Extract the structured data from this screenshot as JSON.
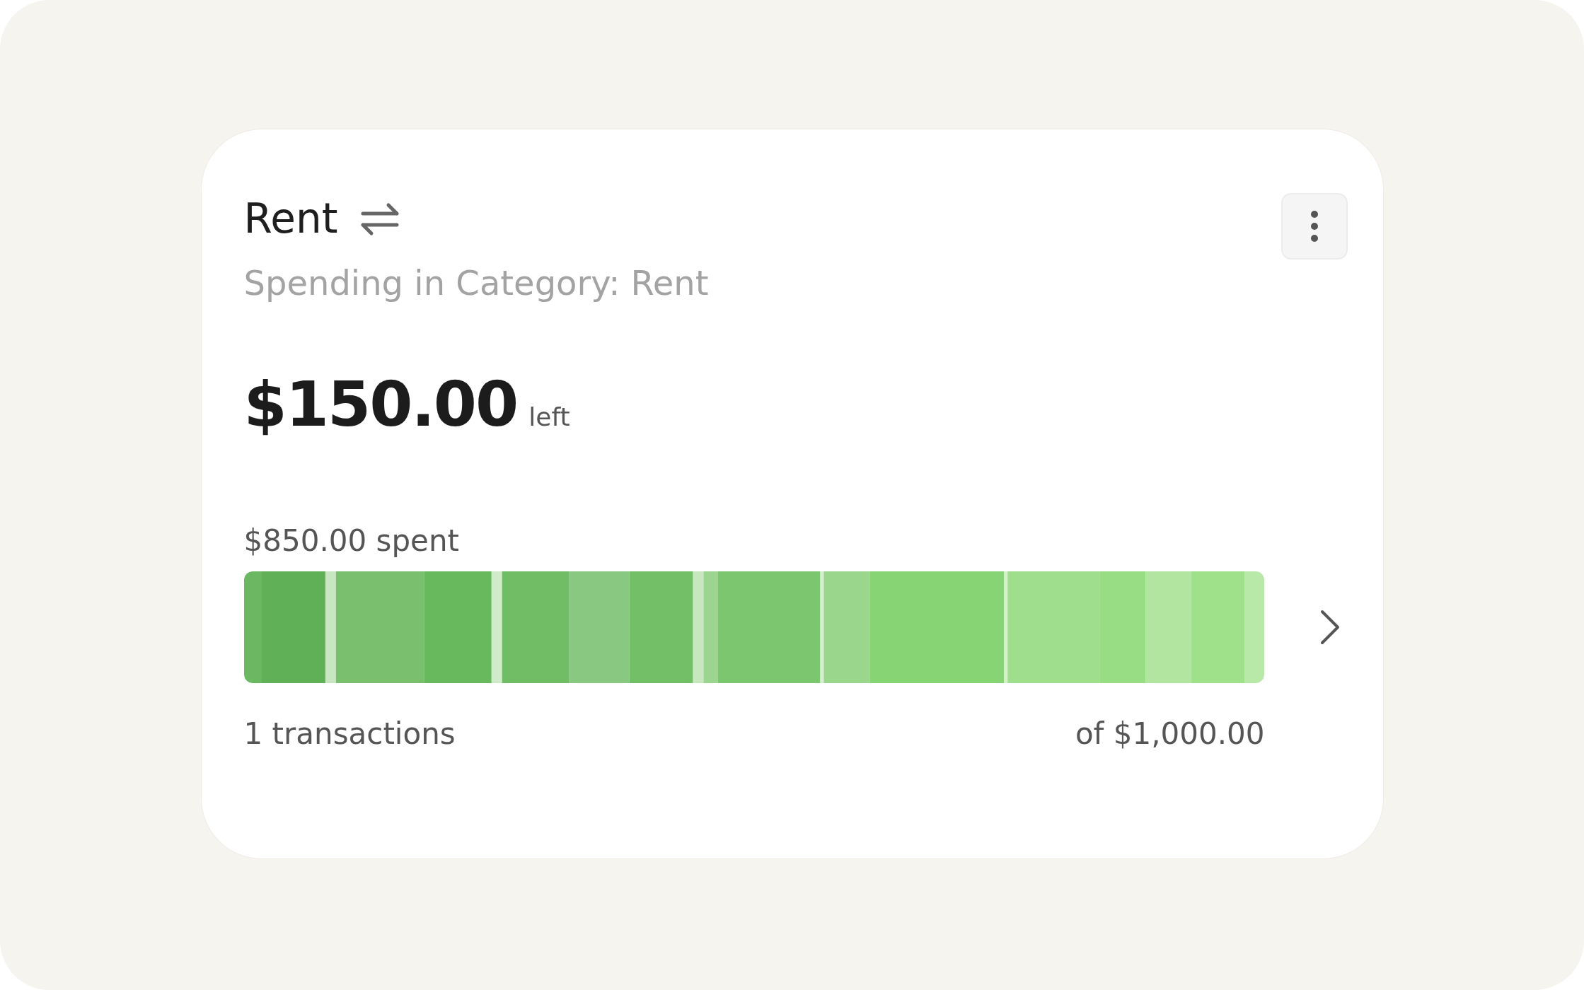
{
  "card": {
    "title": "Rent",
    "subtitle": "Spending in Category: Rent",
    "amount": "$150.00",
    "amount_suffix": "left",
    "spent_label": "$850.00 spent",
    "bar": {
      "level": 1
    },
    "transactions": "1 transactions",
    "total": "of $1,000.00"
  }
}
